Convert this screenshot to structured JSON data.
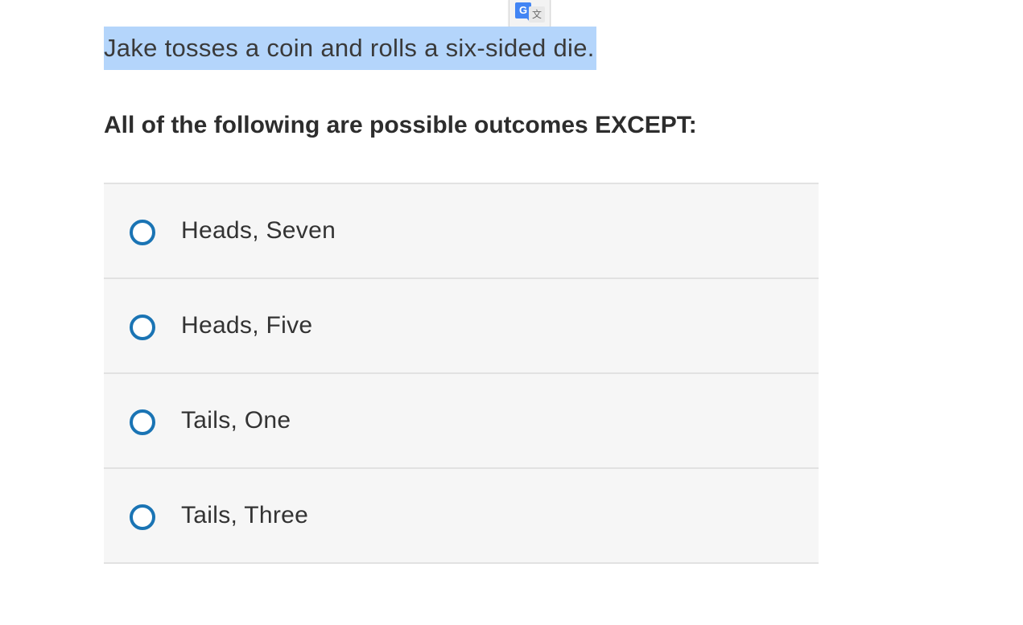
{
  "translate_widget": {
    "g_glyph": "G",
    "wen_glyph": "文"
  },
  "question": {
    "stem": "Jake tosses a coin and rolls a six-sided die.",
    "prompt": "All of the following are possible outcomes EXCEPT:"
  },
  "choices": [
    {
      "label": "Heads, Seven"
    },
    {
      "label": "Heads, Five"
    },
    {
      "label": "Tails, One"
    },
    {
      "label": "Tails, Three"
    }
  ],
  "colors": {
    "selection_highlight": "#b4d5fb",
    "radio_accent": "#1a74b4",
    "choice_background": "#f6f6f6",
    "divider": "#e2e2e2"
  }
}
